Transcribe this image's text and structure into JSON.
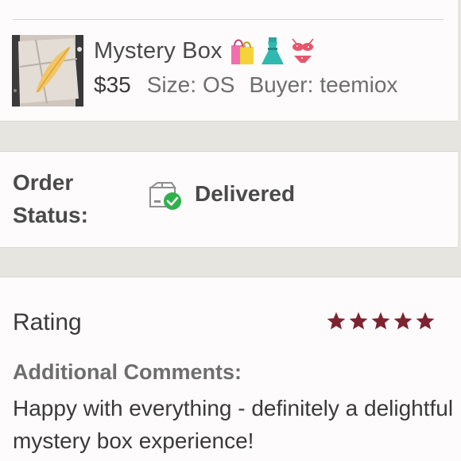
{
  "product": {
    "title": "Mystery Box",
    "emoji_icons": [
      "shopping-bags-icon",
      "dress-icon",
      "bikini-icon"
    ],
    "price": "$35",
    "size_label": "Size:",
    "size_value": "OS",
    "buyer_label": "Buyer:",
    "buyer_value": "teemiox"
  },
  "order": {
    "status_label": "Order Status:",
    "status_value": "Delivered",
    "status_icon": "package-delivered-icon"
  },
  "rating": {
    "label": "Rating",
    "stars": 5,
    "max_stars": 5,
    "star_color": "#7d2430",
    "comments_heading": "Additional Comments:",
    "comments_text": "Happy with everything - definitely a delightful mystery box experience!"
  },
  "colors": {
    "background": "#e7e5e0",
    "card": "#fdfbfb",
    "check_green": "#2fb14b"
  }
}
